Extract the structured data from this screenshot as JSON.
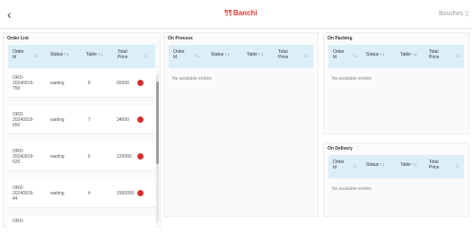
{
  "header": {
    "back_icon": "‹",
    "brand_mark": "¶¶",
    "brand": "Banchi",
    "user_label": "Bouches",
    "user_icon": "▯"
  },
  "columns": {
    "order_id_top": "Order",
    "order_id_bottom": "Id",
    "status": "Status",
    "table": "Table",
    "total_top": "Total",
    "total_bottom": "Price",
    "sort_icon": "↑↓"
  },
  "panels": {
    "order_list": {
      "title": "Order List",
      "rows": [
        {
          "id_1": "ORD-",
          "id_2": "20240919-",
          "id_3": "759",
          "status": "waiting",
          "table": "8",
          "total": "65000"
        },
        {
          "id_1": "ORD-",
          "id_2": "20240919-",
          "id_3": "650",
          "status": "waiting",
          "table": "7",
          "total": "34000"
        },
        {
          "id_1": "ORD-",
          "id_2": "20240919-",
          "id_3": "625",
          "status": "waiting",
          "table": "6",
          "total": "120000"
        },
        {
          "id_1": "ORD-",
          "id_2": "20240919-",
          "id_3": "44",
          "status": "waiting",
          "table": "4",
          "total": "1560000"
        },
        {
          "id_1": "ORD-",
          "id_2": "",
          "id_3": "",
          "status": "",
          "table": "",
          "total": ""
        }
      ]
    },
    "on_process": {
      "title": "On Process",
      "empty": "No available entries"
    },
    "on_packing": {
      "title": "On Packing",
      "empty": "No available entries"
    },
    "on_delivery": {
      "title": "On Delivery",
      "empty": "No available entries"
    }
  }
}
